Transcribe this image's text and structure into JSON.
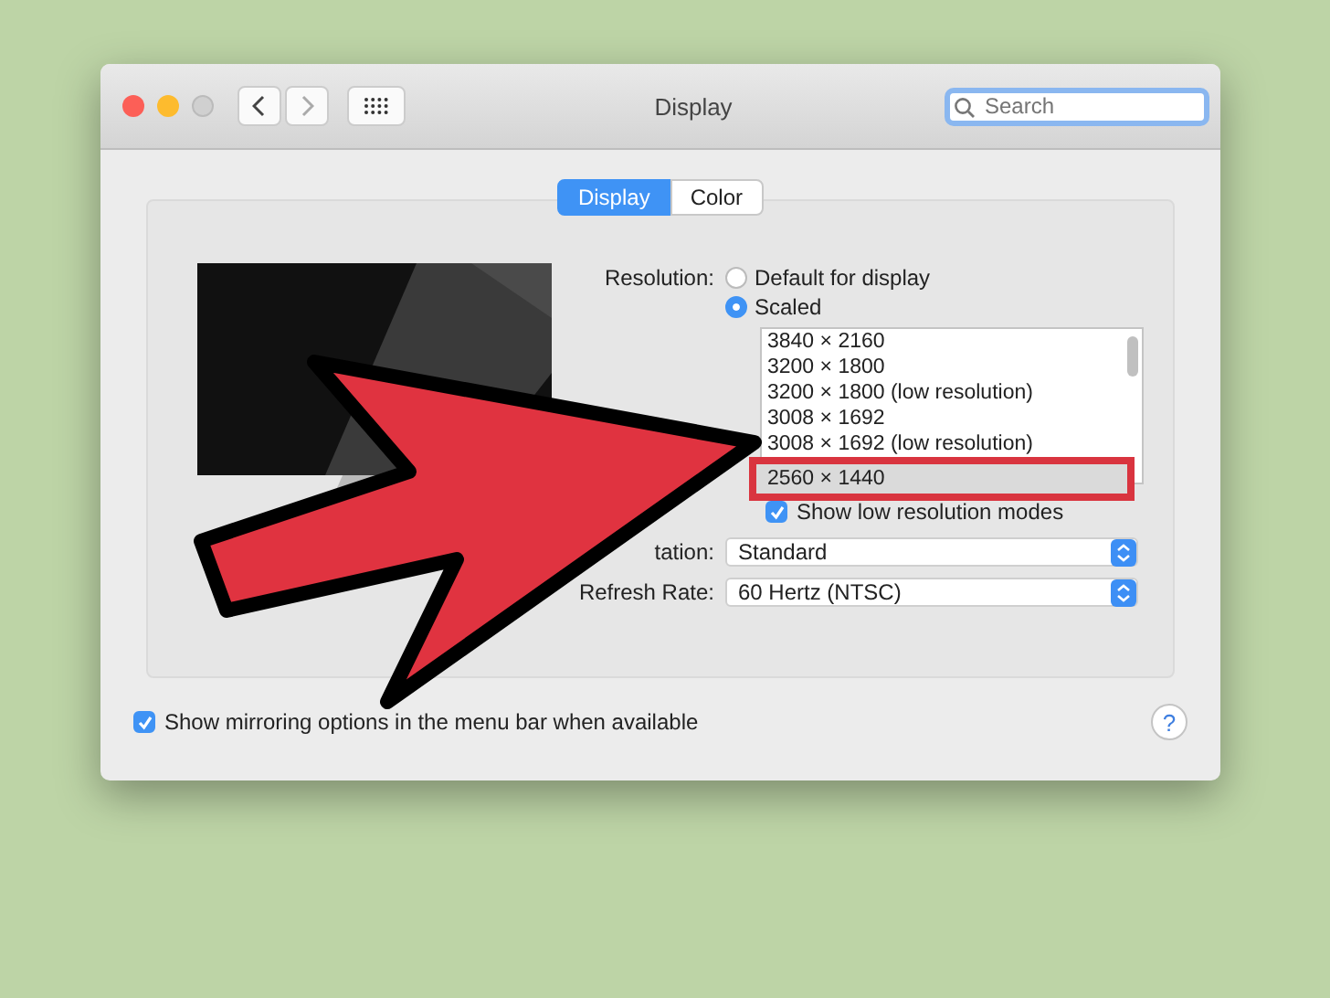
{
  "window": {
    "title": "Display",
    "search": {
      "placeholder": "Search"
    }
  },
  "tabs": [
    {
      "label": "Display",
      "selected": true
    },
    {
      "label": "Color",
      "selected": false
    }
  ],
  "resolution": {
    "label": "Resolution:",
    "options": [
      {
        "label": "Default for display",
        "selected": false
      },
      {
        "label": "Scaled",
        "selected": true
      }
    ],
    "list": [
      {
        "label": "3840 × 2160",
        "selected": false
      },
      {
        "label": "3200 × 1800",
        "selected": false
      },
      {
        "label": "3200 × 1800 (low resolution)",
        "selected": false
      },
      {
        "label": "3008 × 1692",
        "selected": false
      },
      {
        "label": "3008 × 1692 (low resolution)",
        "selected": false
      },
      {
        "label": "2560 × 1440",
        "selected": true
      }
    ]
  },
  "low_res": {
    "label": "Show low resolution modes",
    "checked": true
  },
  "popups": [
    {
      "label": "tation:",
      "value": "Standard"
    },
    {
      "label": "Refresh Rate:",
      "value": "60 Hertz (NTSC)"
    }
  ],
  "mirroring": {
    "label": "Show mirroring options in the menu bar when available",
    "checked": true
  },
  "help": "?"
}
